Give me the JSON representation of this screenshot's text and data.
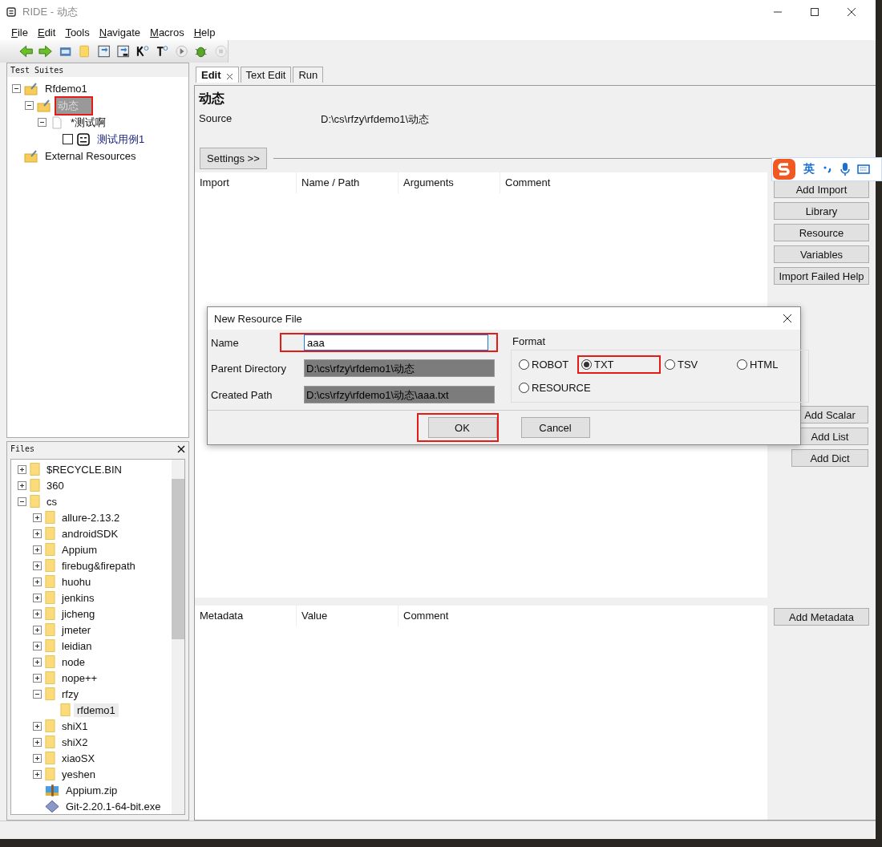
{
  "window": {
    "title": "RIDE - 动态"
  },
  "menu": [
    "File",
    "Edit",
    "Tools",
    "Navigate",
    "Macros",
    "Help"
  ],
  "test_suites": {
    "title": "Test Suites",
    "tree": [
      {
        "label": "Rfdemo1",
        "kind": "suite",
        "expanded": true,
        "selected": false,
        "highlighted": false,
        "children": [
          {
            "label": "动态",
            "kind": "suite",
            "expanded": true,
            "selected": true,
            "highlighted": true,
            "children": [
              {
                "label": "*测试啊",
                "kind": "file",
                "expanded": true,
                "selected": false,
                "highlighted": false,
                "children": [
                  {
                    "label": "测试用例1",
                    "kind": "test",
                    "checked": false,
                    "selected": false,
                    "highlighted": false
                  }
                ]
              }
            ]
          }
        ]
      },
      {
        "label": "External Resources",
        "kind": "suite",
        "selected": false,
        "highlighted": false
      }
    ]
  },
  "files": {
    "title": "Files",
    "tree": [
      {
        "label": "$RECYCLE.BIN",
        "kind": "folder",
        "expanded": false,
        "selected": false
      },
      {
        "label": "360",
        "kind": "folder",
        "expanded": false,
        "selected": false
      },
      {
        "label": "cs",
        "kind": "folder",
        "expanded": true,
        "selected": false,
        "children": [
          {
            "label": "allure-2.13.2",
            "kind": "folder",
            "expanded": false,
            "selected": false
          },
          {
            "label": "androidSDK",
            "kind": "folder",
            "expanded": false,
            "selected": false
          },
          {
            "label": "Appium",
            "kind": "folder",
            "expanded": false,
            "selected": false
          },
          {
            "label": "firebug&firepath",
            "kind": "folder",
            "expanded": false,
            "selected": false
          },
          {
            "label": "huohu",
            "kind": "folder",
            "expanded": false,
            "selected": false
          },
          {
            "label": "jenkins",
            "kind": "folder",
            "expanded": false,
            "selected": false
          },
          {
            "label": "jicheng",
            "kind": "folder",
            "expanded": false,
            "selected": false
          },
          {
            "label": "jmeter",
            "kind": "folder",
            "expanded": false,
            "selected": false
          },
          {
            "label": "leidian",
            "kind": "folder",
            "expanded": false,
            "selected": false
          },
          {
            "label": "node",
            "kind": "folder",
            "expanded": false,
            "selected": false
          },
          {
            "label": "nope++",
            "kind": "folder",
            "expanded": false,
            "selected": false
          },
          {
            "label": "rfzy",
            "kind": "folder",
            "expanded": true,
            "selected": false,
            "children": [
              {
                "label": "rfdemo1",
                "kind": "folder",
                "selected": true
              }
            ]
          },
          {
            "label": "shiX1",
            "kind": "folder",
            "expanded": false,
            "selected": false
          },
          {
            "label": "shiX2",
            "kind": "folder",
            "expanded": false,
            "selected": false
          },
          {
            "label": "xiaoSX",
            "kind": "folder",
            "expanded": false,
            "selected": false
          },
          {
            "label": "yeshen",
            "kind": "folder",
            "expanded": false,
            "selected": false
          },
          {
            "label": "Appium.zip",
            "kind": "archive",
            "selected": false
          },
          {
            "label": "Git-2.20.1-64-bit.exe",
            "kind": "installer",
            "selected": false
          }
        ]
      }
    ]
  },
  "tabs": [
    {
      "label": "Edit",
      "selected": true,
      "closable": true
    },
    {
      "label": "Text Edit",
      "selected": false,
      "closable": false
    },
    {
      "label": "Run",
      "selected": false,
      "closable": false
    }
  ],
  "editor": {
    "title": "动态",
    "source_label": "Source",
    "source_value": "D:\\cs\\rfzy\\rfdemo1\\动态",
    "settings_button": "Settings >>"
  },
  "imports": {
    "columns": [
      "Import",
      "Name / Path",
      "Arguments",
      "Comment"
    ],
    "buttons": [
      "Add Import",
      "Library",
      "Resource",
      "Variables",
      "Import Failed Help"
    ]
  },
  "variables": {
    "buttons": [
      "Add Scalar",
      "Add List",
      "Add Dict"
    ]
  },
  "metadata": {
    "columns": [
      "Metadata",
      "Value",
      "Comment"
    ],
    "buttons": [
      "Add Metadata"
    ]
  },
  "ime": {
    "label": "英"
  },
  "dialog": {
    "title": "New Resource File",
    "fields": [
      {
        "label": "Name",
        "value": "aaa",
        "kind": "input",
        "highlighted": true
      },
      {
        "label": "Parent Directory",
        "value": "D:\\cs\\rfzy\\rfdemo1\\动态",
        "kind": "readonly",
        "highlighted": false
      },
      {
        "label": "Created Path",
        "value": "D:\\cs\\rfzy\\rfdemo1\\动态\\aaa.txt",
        "kind": "readonly",
        "highlighted": false
      }
    ],
    "format": {
      "label": "Format",
      "options": [
        {
          "label": "ROBOT",
          "selected": false,
          "highlighted": false
        },
        {
          "label": "TXT",
          "selected": true,
          "highlighted": true
        },
        {
          "label": "TSV",
          "selected": false,
          "highlighted": false
        },
        {
          "label": "HTML",
          "selected": false,
          "highlighted": false
        },
        {
          "label": "RESOURCE",
          "selected": false,
          "highlighted": false
        }
      ]
    },
    "buttons": [
      {
        "label": "OK",
        "highlighted": true
      },
      {
        "label": "Cancel",
        "highlighted": false
      }
    ]
  }
}
